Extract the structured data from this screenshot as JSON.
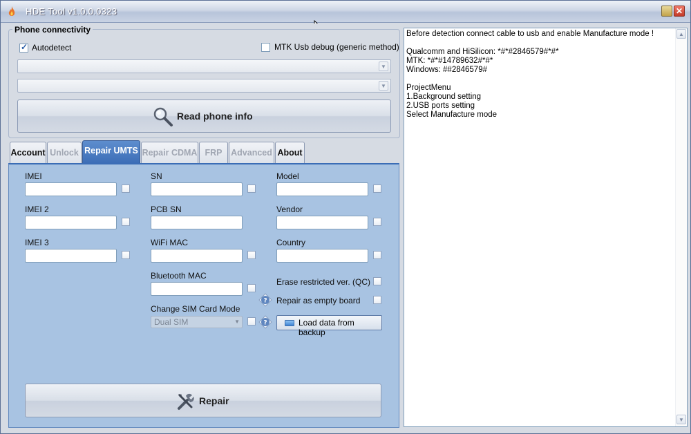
{
  "window": {
    "title": "HDE Tool   v1.0.0.0323"
  },
  "connectivity": {
    "group_title": "Phone connectivity",
    "autodetect_label": "Autodetect",
    "autodetect_checked": true,
    "mtk_debug_label": "MTK Usb debug (generic method)",
    "mtk_debug_checked": false,
    "port_select_1": "",
    "port_select_2": "",
    "read_button_label": "Read phone info",
    "read_button_icon": "magnifier-icon"
  },
  "tabs": [
    {
      "label": "Account",
      "state": "normal"
    },
    {
      "label": "Unlock",
      "state": "disabled"
    },
    {
      "label": "Repair UMTS",
      "state": "active"
    },
    {
      "label": "Repair CDMA",
      "state": "disabled"
    },
    {
      "label": "FRP",
      "state": "disabled"
    },
    {
      "label": "Advanced",
      "state": "disabled"
    },
    {
      "label": "About",
      "state": "normal"
    }
  ],
  "repair": {
    "fields": {
      "imei": "IMEI",
      "imei2": "IMEI 2",
      "imei3": "IMEI 3",
      "sn": "SN",
      "pcb_sn": "PCB SN",
      "wifi_mac": "WiFi MAC",
      "bt_mac": "Bluetooth MAC",
      "model": "Model",
      "vendor": "Vendor",
      "country": "Country"
    },
    "change_sim_label": "Change SIM Card Mode",
    "sim_mode_value": "Dual SIM",
    "erase_restricted_label": "Erase restricted ver. (QC)",
    "repair_empty_label": "Repair as empty board",
    "load_backup_label": "Load data from backup",
    "repair_button_label": "Repair",
    "repair_button_icon": "tools-icon"
  },
  "log": {
    "text": "Before detection connect cable to usb and enable Manufacture mode !\n\nQualcomm and HiSilicon: *#*#2846579#*#*\nMTK: *#*#14789632#*#*\nWindows: ##2846579#\n\nProjectMenu\n1.Background setting\n2.USB ports setting\nSelect Manufacture mode"
  },
  "colors": {
    "panel_bg": "#a8c3e2",
    "active_tab": "#3b6db6",
    "window_bg": "#d6dbe3"
  }
}
